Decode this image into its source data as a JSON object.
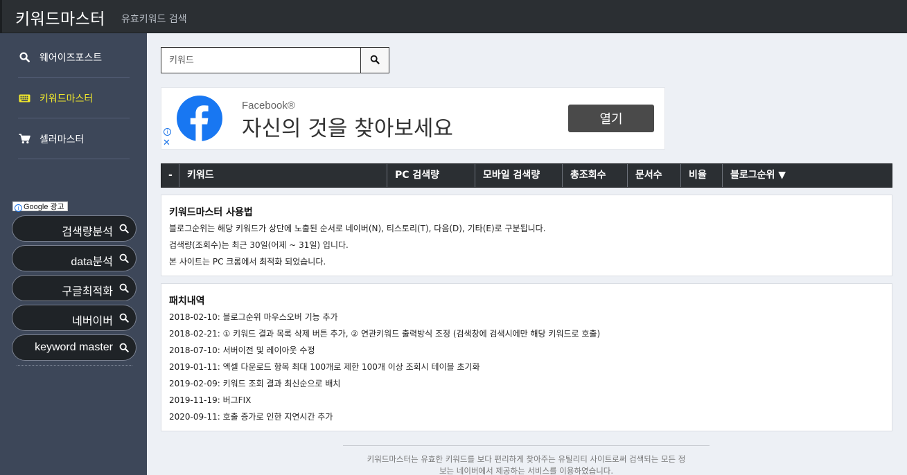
{
  "header": {
    "title": "키워드마스터",
    "subtitle": "유효키워드 검색"
  },
  "sidebar": {
    "items": [
      {
        "label": "웨어이즈포스트",
        "icon": "search-icon"
      },
      {
        "label": "키워드마스터",
        "icon": "keyboard-icon",
        "active": true
      },
      {
        "label": "셀러마스터",
        "icon": "cart-icon"
      }
    ],
    "ad_label": "Google 광고",
    "ad_links": [
      "검색량분석",
      "data분석",
      "구글최적화",
      "네버이버",
      "keyword master"
    ]
  },
  "search": {
    "placeholder": "키워드"
  },
  "banner_ad": {
    "brand": "Facebook®",
    "headline": "자신의 것을 찾아보세요",
    "button": "열기"
  },
  "table": {
    "headers": [
      "-",
      "키워드",
      "PC 검색량",
      "모바일 검색량",
      "총조회수",
      "문서수",
      "비율",
      "블로그순위 ▼"
    ]
  },
  "usage": {
    "title": "키워드마스터 사용법",
    "lines": [
      "블로그순위는 해당 키워드가 상단에 노출된 순서로 네이버(N), 티스토리(T), 다음(D), 기타(E)로 구분됩니다.",
      "검색량(조회수)는 최근 30일(어제 ~ 31일) 입니다.",
      "본 사이트는 PC 크롬에서 최적화 되었습니다."
    ]
  },
  "patch": {
    "title": "패치내역",
    "lines": [
      "2018-02-10: 블로그순위 마우스오버 기능 추가",
      "2018-02-21: ① 키워드 결과 목록 삭제 버튼 추가, ② 연관키워드 출력방식 조정 (검색창에 검색시에만 해당 키워드로 호출)",
      "2018-07-10: 서버이전 및 레이아웃 수정",
      "2019-01-11: 엑셀 다운로드 항목 최대 100개로 제한 100개 이상 조회시 테이블 초기화",
      "2019-02-09: 키워드 조회 결과 최신순으로 배치",
      "2019-11-19: 버그FIX",
      "2020-09-11: 호출 증가로 인한 지연시간 추가"
    ]
  },
  "footer": {
    "text_line1": "키워드마스터는 유효한 키워드를 보다 편리하게 찾아주는 유틸리티 사이트로써 검색되는 모든 정",
    "text_line2": "보는 네이버에서 제공하는 서비스를 이용하였습니다."
  },
  "colors": {
    "topbar": "#2b2f33",
    "sidebar": "#3d4759",
    "active": "#f2e92c",
    "facebook": "#1877f2"
  }
}
